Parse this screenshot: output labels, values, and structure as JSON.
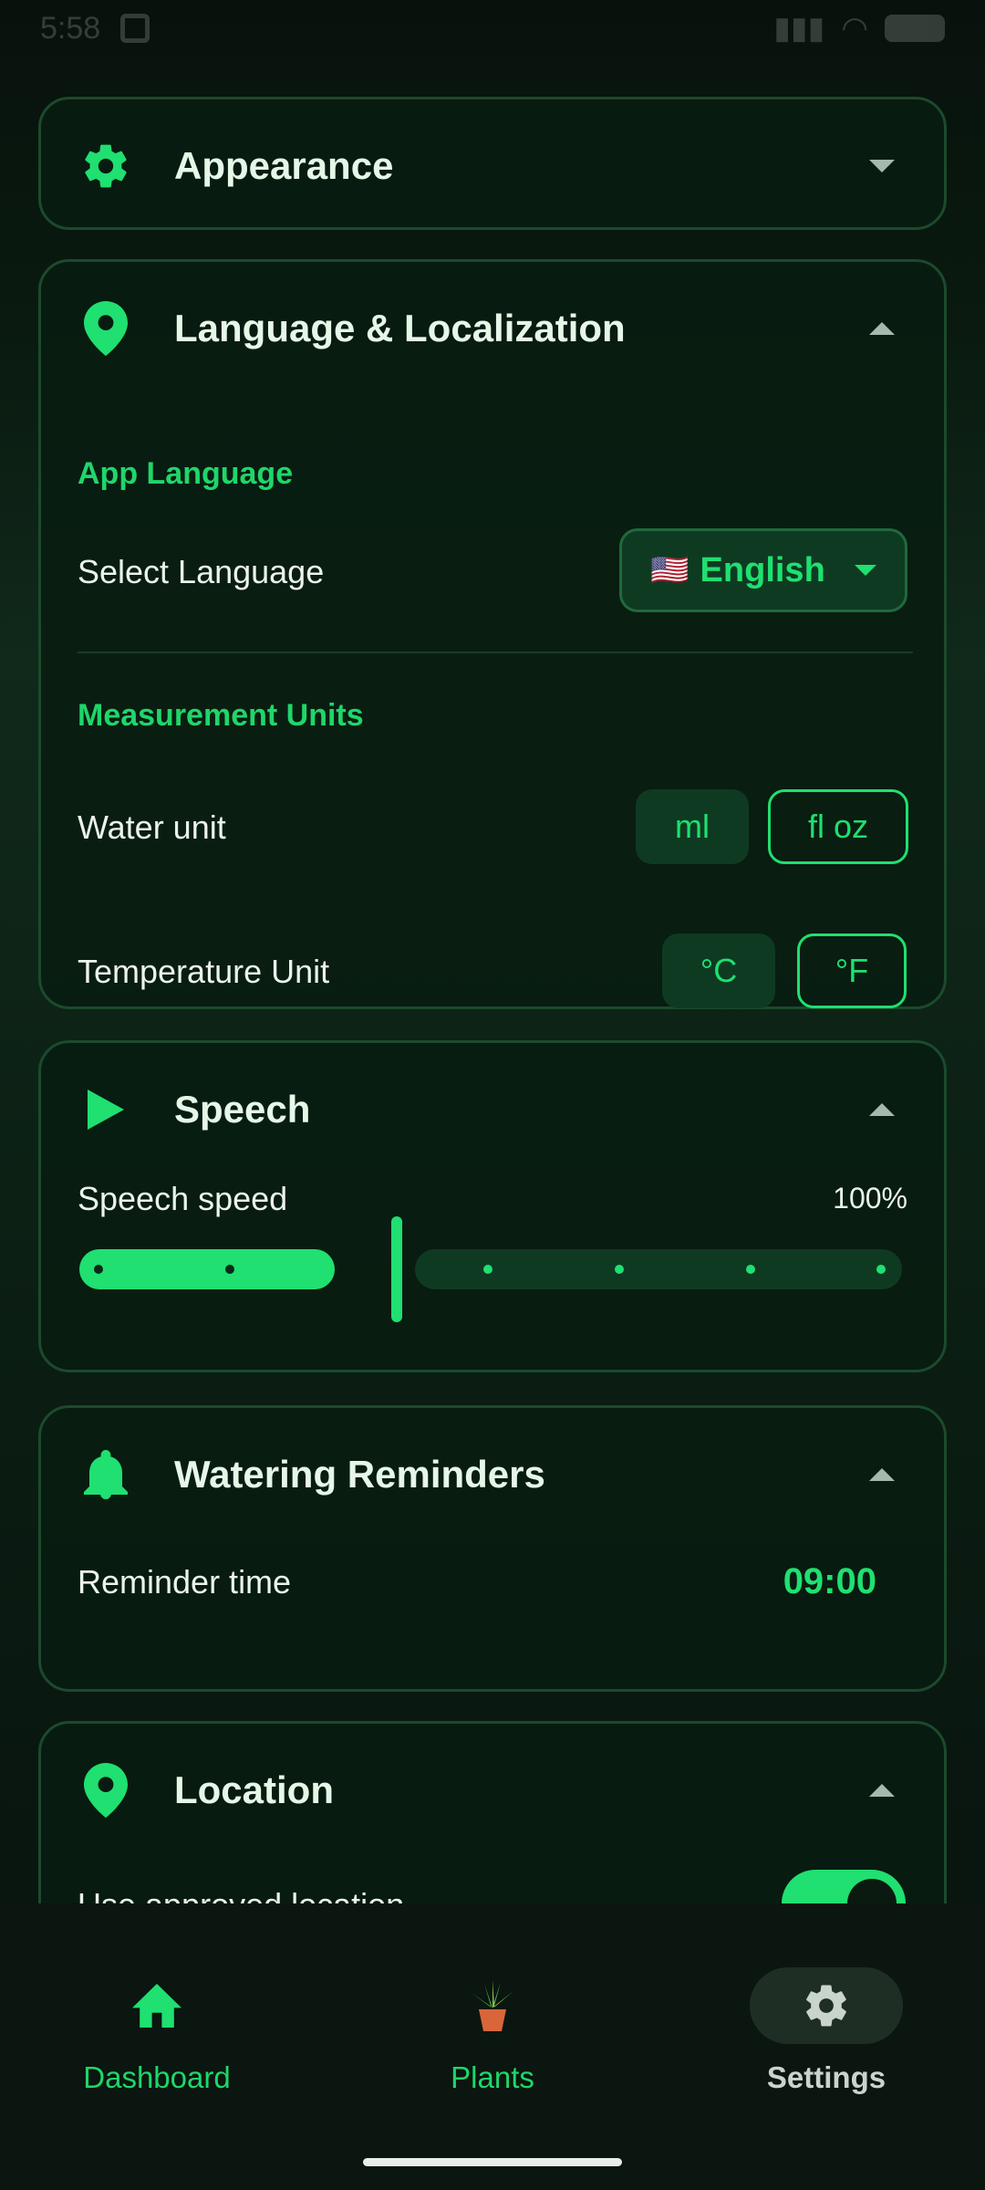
{
  "status_bar": {
    "time": "5:58"
  },
  "sections": {
    "appearance": {
      "title": "Appearance"
    },
    "language": {
      "title": "Language & Localization",
      "app_language_label": "App Language",
      "select_language_label": "Select Language",
      "selected_language_flag": "🇺🇸",
      "selected_language": "English",
      "measurement_units_label": "Measurement Units",
      "water_unit_label": "Water unit",
      "water_unit_options": [
        "ml",
        "fl oz"
      ],
      "temperature_unit_label": "Temperature Unit",
      "temperature_unit_options": [
        "°C",
        "°F"
      ]
    },
    "speech": {
      "title": "Speech",
      "speed_label": "Speech speed",
      "speed_value": "100%",
      "slider_level": 0.33
    },
    "reminders": {
      "title": "Watering Reminders",
      "time_label": "Reminder time",
      "time_value": "09:00"
    },
    "location": {
      "title": "Location",
      "toggle_label": "Use approved location",
      "toggle_on": true
    }
  },
  "bottom_nav": {
    "items": [
      {
        "label": "Dashboard",
        "icon": "home-icon"
      },
      {
        "label": "Plants",
        "icon": "plant-icon"
      },
      {
        "label": "Settings",
        "icon": "gear-icon",
        "active": true
      }
    ]
  },
  "colors": {
    "accent": "#1fe070",
    "card_border": "#1c4a2c",
    "background": "#0a1a10"
  }
}
